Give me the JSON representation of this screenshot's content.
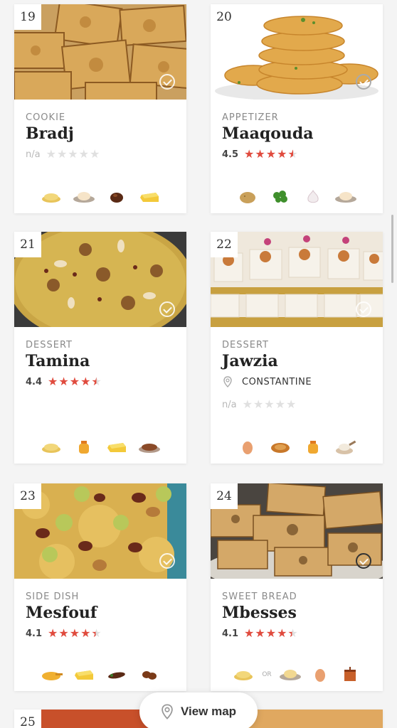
{
  "cards": [
    {
      "num": "19",
      "category": "COOKIE",
      "name": "Bradj",
      "rating": "n/a",
      "stars": 0,
      "ingredients": [
        "semolina-icon",
        "flour-bowl-icon",
        "dates-icon",
        "butter-icon"
      ]
    },
    {
      "num": "20",
      "category": "APPETIZER",
      "name": "Maaqouda",
      "rating": "4.5",
      "stars": 4.5,
      "ingredients": [
        "potato-icon",
        "parsley-icon",
        "garlic-icon",
        "flour-bowl-icon"
      ]
    },
    {
      "num": "21",
      "category": "DESSERT",
      "name": "Tamina",
      "rating": "4.4",
      "stars": 4.5,
      "ingredients": [
        "semolina-icon",
        "honey-icon",
        "butter-icon",
        "cinnamon-icon"
      ]
    },
    {
      "num": "22",
      "category": "DESSERT",
      "name": "Jawzia",
      "location": "CONSTANTINE",
      "rating": "n/a",
      "stars": 0,
      "ingredients": [
        "egg-icon",
        "walnut-icon",
        "honey-icon",
        "sugar-icon"
      ]
    },
    {
      "num": "23",
      "category": "SIDE DISH",
      "name": "Mesfouf",
      "rating": "4.1",
      "stars": 4.5,
      "ingredients": [
        "oil-icon",
        "butter-icon",
        "raisin-icon",
        "dates-icon"
      ]
    },
    {
      "num": "24",
      "category": "SWEET BREAD",
      "name": "Mbesses",
      "rating": "4.1",
      "stars": 4.5,
      "ingredients": [
        "semolina-icon",
        "flour-bowl-icon",
        "egg-icon",
        "butter-churn-icon"
      ],
      "or_label": "OR"
    }
  ],
  "next_card_num": "25",
  "view_map_label": "View map",
  "colors": {
    "star": "#e04b3e",
    "star_empty": "#e0e0e0",
    "background": "#f4f4f4"
  }
}
